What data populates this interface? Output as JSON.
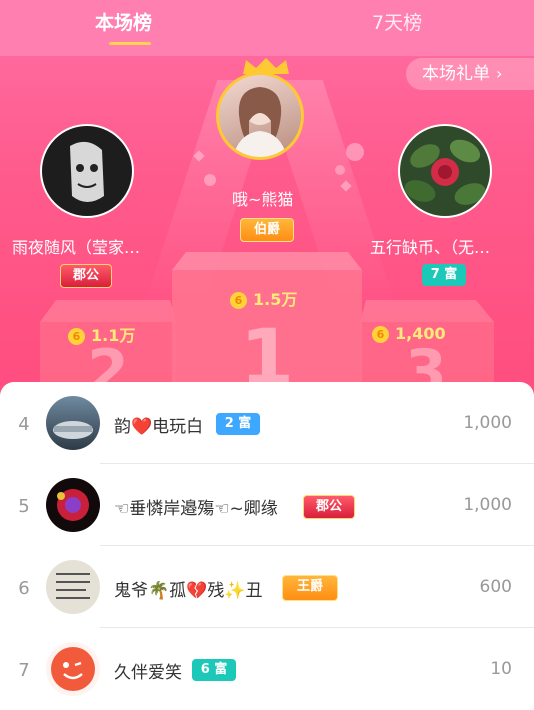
{
  "tabs": [
    {
      "label": "本场榜",
      "active": true
    },
    {
      "label": "7天榜",
      "active": false
    }
  ],
  "gift_button": {
    "label": "本场礼单",
    "icon": "chevron-right-icon"
  },
  "podium": {
    "first": {
      "rank": "1",
      "name": "哦~熊猫",
      "badge": "伯爵",
      "amount": "1.5万"
    },
    "second": {
      "rank": "2",
      "name": "雨夜随风（莹家…",
      "badge": "郡公",
      "amount": "1.1万"
    },
    "third": {
      "rank": "3",
      "name": "五行缺币、（无…",
      "badge": "7 富",
      "amount": "1,400"
    }
  },
  "coin_symbol": "6",
  "list": [
    {
      "rank": "4",
      "name": "韵❤️电玩白",
      "badge": "2 富",
      "score": "1,000"
    },
    {
      "rank": "5",
      "name": "☜垂憐岸邉殤☜~卿缘",
      "badge": "郡公",
      "score": "1,000"
    },
    {
      "rank": "6",
      "name": "鬼爷🌴孤💔残✨丑",
      "badge": "王爵",
      "score": "600"
    },
    {
      "rank": "7",
      "name": "久伴爱笑",
      "badge": "6 富",
      "score": "10"
    }
  ],
  "colors": {
    "accent": "#ff5a8c",
    "tab_bar": "#ff7fb0",
    "tab_underline": "#ffd34d",
    "coin": "#ffd23a",
    "fu_badge": "#1cc9b8",
    "fu_badge_blue": "#3ea7ff",
    "title_badge_red": "#e8334f",
    "title_badge_gold": "#ff9d1e"
  }
}
